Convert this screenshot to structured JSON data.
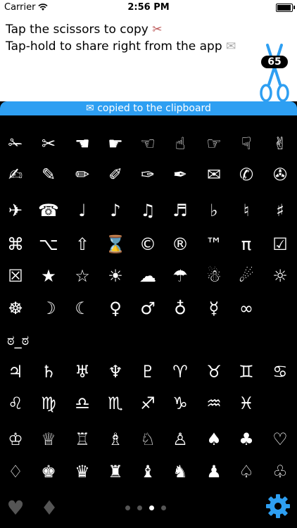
{
  "status_bar": {
    "carrier": "Carrier",
    "time": "2:56 PM",
    "battery_fraction": 0.95
  },
  "header": {
    "line1": "Tap the scissors to copy",
    "line1_icon": "✂",
    "line2": "Tap-hold to share right from the app",
    "line2_icon": "✉",
    "count": "65"
  },
  "banner": {
    "icon": "✉",
    "text": "copied to the clipboard"
  },
  "symbols": {
    "rows": [
      [
        "✁",
        "✂",
        "☚",
        "☛",
        "☜",
        "☝",
        "☞",
        "☟",
        "✌"
      ],
      [
        "✍",
        "✎",
        "✏",
        "✐",
        "✑",
        "✒",
        "✉",
        "✆",
        "✇"
      ],
      [
        "✈",
        "☎",
        "♩",
        "♪",
        "♫",
        "♬",
        "♭",
        "♮",
        "♯"
      ],
      [
        "⌘",
        "⌥",
        "⇧",
        "⌛",
        "©",
        "®",
        "™",
        "π",
        "☑"
      ],
      [
        "☒",
        "★",
        "☆",
        "☀",
        "☁",
        "☂",
        "☃",
        "☄",
        "☼"
      ],
      [
        "☸",
        "☽",
        "☾",
        "♀",
        "♂",
        "♁",
        "☿",
        "∞"
      ],
      [
        "ಠ_ಠ"
      ],
      [
        "♃",
        "♄",
        "♅",
        "♆",
        "♇",
        "♈",
        "♉",
        "♊",
        "♋"
      ],
      [
        "♌",
        "♍",
        "♎",
        "♏",
        "♐",
        "♑",
        "♒",
        "♓"
      ],
      [
        "♔",
        "♕",
        "♖",
        "♗",
        "♘",
        "♙",
        "♠",
        "♣",
        "♡"
      ],
      [
        "♢",
        "♚",
        "♛",
        "♜",
        "♝",
        "♞",
        "♟",
        "♤",
        "♧"
      ]
    ]
  },
  "bottom_bar": {
    "left_icons": [
      "♥",
      "♦"
    ],
    "page_dots": 4,
    "active_page": 3,
    "settings_icon": "gear-icon"
  },
  "colors": {
    "accent": "#2e9ff2"
  }
}
